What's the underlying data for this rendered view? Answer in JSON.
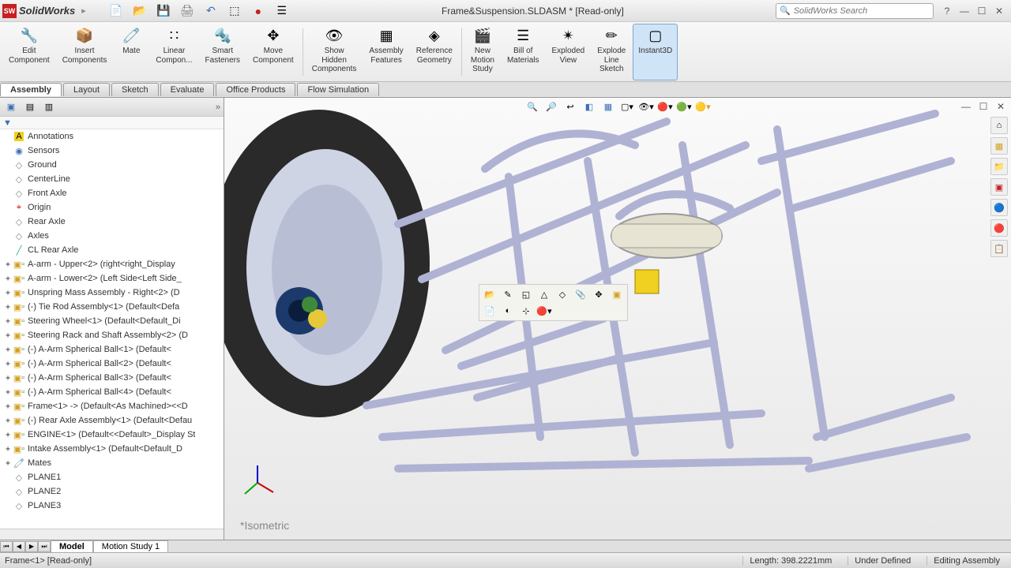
{
  "app": {
    "name": "SolidWorks",
    "logo_text": "SW"
  },
  "title": "Frame&Suspension.SLDASM * [Read-only]",
  "search": {
    "placeholder": "SolidWorks Search"
  },
  "ribbon": [
    {
      "id": "edit-component",
      "label": "Edit\nComponent"
    },
    {
      "id": "insert-components",
      "label": "Insert\nComponents"
    },
    {
      "id": "mate",
      "label": "Mate"
    },
    {
      "id": "linear-pattern",
      "label": "Linear\nCompon..."
    },
    {
      "id": "smart-fasteners",
      "label": "Smart\nFasteners"
    },
    {
      "id": "move-component",
      "label": "Move\nComponent"
    },
    {
      "id": "show-hidden",
      "label": "Show\nHidden\nComponents"
    },
    {
      "id": "assembly-features",
      "label": "Assembly\nFeatures"
    },
    {
      "id": "reference-geometry",
      "label": "Reference\nGeometry"
    },
    {
      "id": "new-motion-study",
      "label": "New\nMotion\nStudy"
    },
    {
      "id": "bom",
      "label": "Bill of\nMaterials"
    },
    {
      "id": "exploded-view",
      "label": "Exploded\nView"
    },
    {
      "id": "explode-line",
      "label": "Explode\nLine\nSketch"
    },
    {
      "id": "instant3d",
      "label": "Instant3D",
      "active": true
    }
  ],
  "tabs": [
    "Assembly",
    "Layout",
    "Sketch",
    "Evaluate",
    "Office Products",
    "Flow Simulation"
  ],
  "active_tab": "Assembly",
  "tree": [
    {
      "exp": "",
      "icon": "annotations",
      "label": "Annotations"
    },
    {
      "exp": "",
      "icon": "sensors",
      "label": "Sensors"
    },
    {
      "exp": "",
      "icon": "plane",
      "label": "Ground"
    },
    {
      "exp": "",
      "icon": "plane",
      "label": "CenterLine"
    },
    {
      "exp": "",
      "icon": "plane",
      "label": "Front Axle"
    },
    {
      "exp": "",
      "icon": "origin",
      "label": "Origin"
    },
    {
      "exp": "",
      "icon": "plane",
      "label": "Rear Axle"
    },
    {
      "exp": "",
      "icon": "plane",
      "label": "Axles"
    },
    {
      "exp": "",
      "icon": "axis",
      "label": "CL Rear Axle"
    },
    {
      "exp": "+",
      "icon": "part",
      "label": "A-arm - Upper<2> (right<right_Display"
    },
    {
      "exp": "+",
      "icon": "part",
      "label": "A-arm - Lower<2> (Left Side<Left Side_"
    },
    {
      "exp": "+",
      "icon": "asm",
      "label": "Unspring Mass Assembly - Right<2> (D"
    },
    {
      "exp": "+",
      "icon": "asm",
      "label": "(-) Tie Rod Assembly<1> (Default<Defa"
    },
    {
      "exp": "+",
      "icon": "asm",
      "label": "Steering Wheel<1> (Default<Default_Di"
    },
    {
      "exp": "+",
      "icon": "asm",
      "label": "Steering Rack and Shaft Assembly<2> (D"
    },
    {
      "exp": "+",
      "icon": "part",
      "label": "(-) A-Arm Spherical Ball<1> (Default<"
    },
    {
      "exp": "+",
      "icon": "part",
      "label": "(-) A-Arm Spherical Ball<2> (Default<"
    },
    {
      "exp": "+",
      "icon": "part",
      "label": "(-) A-Arm Spherical Ball<3> (Default<"
    },
    {
      "exp": "+",
      "icon": "part",
      "label": "(-) A-Arm Spherical Ball<4> (Default<"
    },
    {
      "exp": "+",
      "icon": "asm",
      "label": "Frame<1> -> (Default<As Machined><<D"
    },
    {
      "exp": "+",
      "icon": "asm",
      "label": "(-) Rear Axle Assembly<1> (Default<Defau"
    },
    {
      "exp": "+",
      "icon": "asm",
      "label": "ENGINE<1> (Default<<Default>_Display St"
    },
    {
      "exp": "+",
      "icon": "asm",
      "label": "Intake Assembly<1> (Default<Default_D"
    },
    {
      "exp": "+",
      "icon": "mates",
      "label": "Mates"
    },
    {
      "exp": "",
      "icon": "plane",
      "label": "PLANE1"
    },
    {
      "exp": "",
      "icon": "plane",
      "label": "PLANE2"
    },
    {
      "exp": "",
      "icon": "plane",
      "label": "PLANE3"
    }
  ],
  "viewport": {
    "orientation": "*Isometric"
  },
  "bottom_tabs": [
    "Model",
    "Motion Study 1"
  ],
  "active_bottom_tab": "Model",
  "status": {
    "left": "Frame<1> [Read-only]",
    "length": "Length: 398.2221mm",
    "defined": "Under Defined",
    "mode": "Editing Assembly"
  }
}
